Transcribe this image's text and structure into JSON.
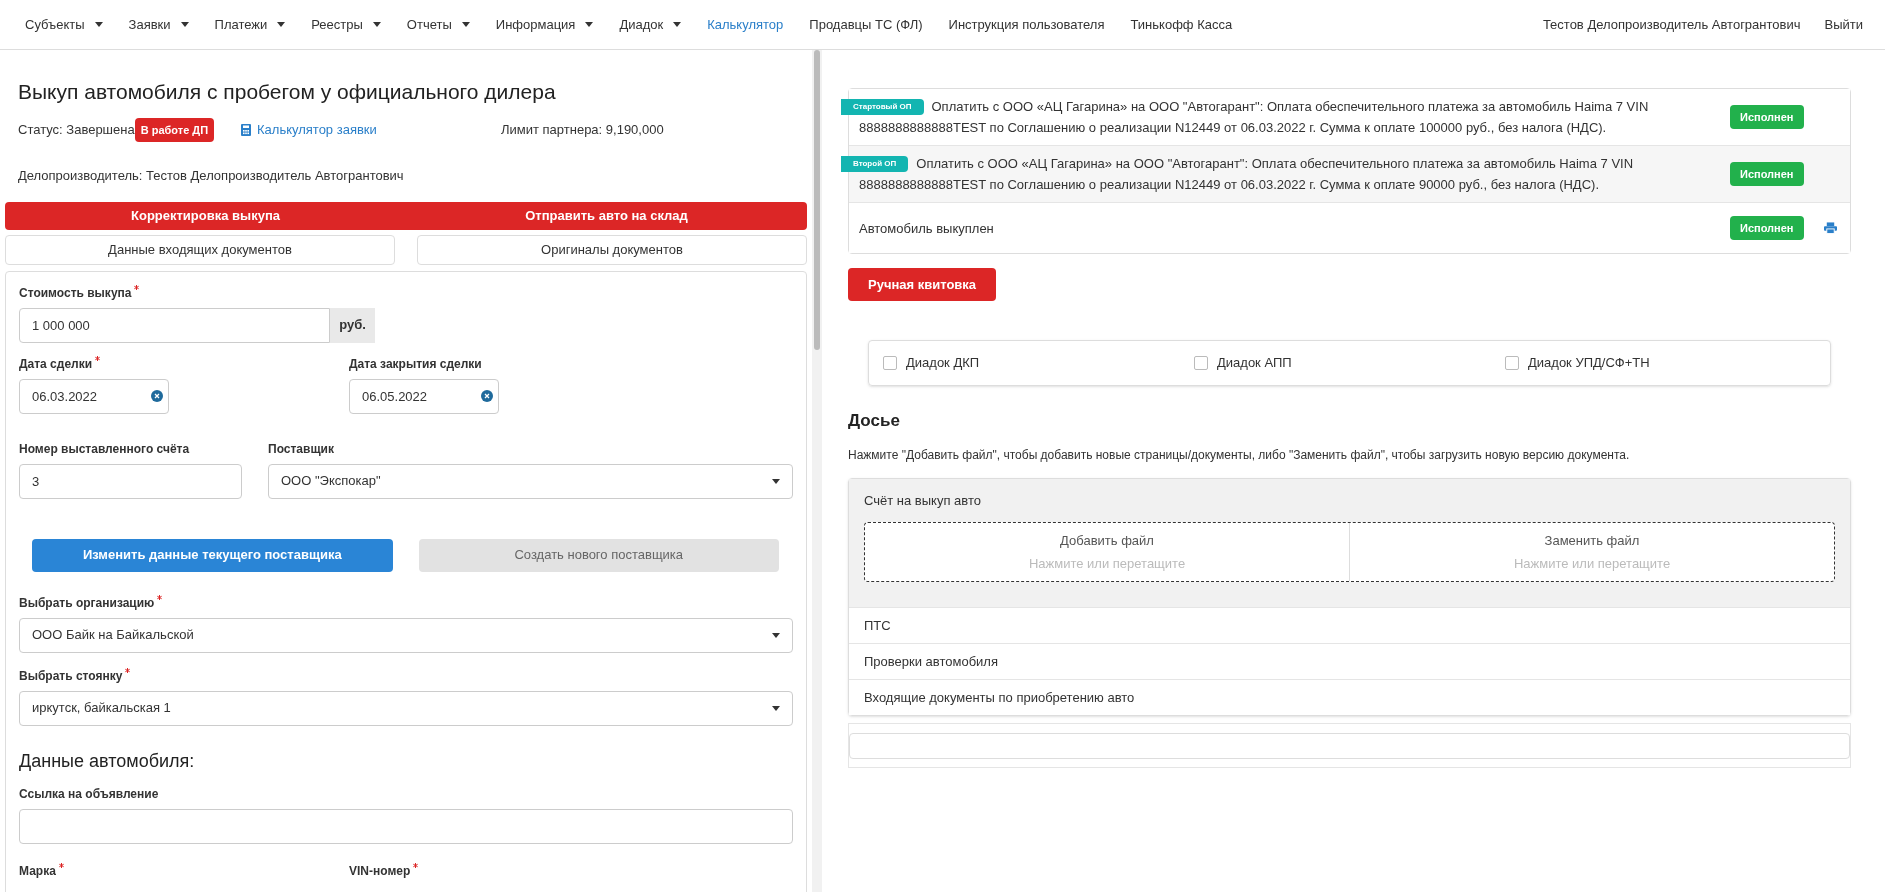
{
  "nav": {
    "items": [
      {
        "label": "Субъекты",
        "kind": "dropdown",
        "selected": false
      },
      {
        "label": "Заявки",
        "kind": "dropdown",
        "selected": false
      },
      {
        "label": "Платежи",
        "kind": "dropdown",
        "selected": false
      },
      {
        "label": "Реестры",
        "kind": "dropdown",
        "selected": false
      },
      {
        "label": "Отчеты",
        "kind": "dropdown",
        "selected": false
      },
      {
        "label": "Информация",
        "kind": "dropdown",
        "selected": false
      },
      {
        "label": "Диадок",
        "kind": "dropdown",
        "selected": false
      },
      {
        "label": "Калькулятор",
        "kind": "link",
        "selected": true
      },
      {
        "label": "Продавцы ТС (ФЛ)",
        "kind": "link",
        "selected": false
      },
      {
        "label": "Инструкция пользователя",
        "kind": "link",
        "selected": false
      },
      {
        "label": "Тинькофф Касса",
        "kind": "link",
        "selected": false
      }
    ],
    "user": "Тестов Делопроизводитель Автогрантович",
    "logout": "Выйти"
  },
  "header": {
    "title": "Выкуп автомобиля с пробегом у официального дилера",
    "status": "Статус: Завершена",
    "status_badge": "В работе ДП",
    "calculator_link": "Калькулятор заявки",
    "limit": "Лимит партнера: 9,190,000",
    "clerk": "Делопроизводитель: Тестов Делопроизводитель Автогрантович"
  },
  "action_bar": [
    "Корректировка выкупа",
    "Отправить авто на склад"
  ],
  "doc_buttons": [
    "Данные входящих документов",
    "Оригиналы документов"
  ],
  "form": {
    "price": {
      "label": "Стоимость выкупа",
      "required": true,
      "value": "1 000 000",
      "suffix": "руб."
    },
    "deal_date": {
      "label": "Дата сделки",
      "required": true,
      "value": "06.03.2022"
    },
    "close_date": {
      "label": "Дата закрытия сделки",
      "required": false,
      "value": "06.05.2022"
    },
    "invoice": {
      "label": "Номер выставленного счёта",
      "required": false,
      "value": "3"
    },
    "supplier": {
      "label": "Поставщик",
      "required": false,
      "value": "ООО \"Экспокар\""
    },
    "supplier_buttons": [
      {
        "label": "Изменить данные текущего поставщика",
        "disabled": false
      },
      {
        "label": "Создать нового поставщика",
        "disabled": true
      }
    ],
    "organization": {
      "label": "Выбрать организацию",
      "required": true,
      "value": "ООО Байк на Байкальской"
    },
    "parking": {
      "label": "Выбрать стоянку",
      "required": true,
      "value": "иркутск, байкальская 1"
    },
    "car_heading": "Данные автомобиля:",
    "ad_link": {
      "label": "Ссылка на объявление",
      "required": false
    },
    "brand": {
      "label": "Марка",
      "required": true
    },
    "vin": {
      "label": "VIN-номер",
      "required": true
    }
  },
  "steps": [
    {
      "badge": "Стартовый ОП",
      "text": "Оплатить с ООО «АЦ Гагарина» на ООО \"Автогарант\": Оплата обеспечительного платежа за автомобиль Haima 7 VIN 8888888888888TEST по Соглашению о реализации N12449 от 06.03.2022 г. Сумма к оплате 100000 руб., без налога (НДС).",
      "status": "Исполнен",
      "printable": false
    },
    {
      "badge": "Второй ОП",
      "text": "Оплатить с ООО «АЦ Гагарина» на ООО \"Автогарант\": Оплата обеспечительного платежа за автомобиль Haima 7 VIN 8888888888888TEST по Соглашению о реализации N12449 от 06.03.2022 г. Сумма к оплате 90000 руб., без налога (НДС).",
      "status": "Исполнен",
      "printable": false
    },
    {
      "text": "Автомобиль выкуплен",
      "status": "Исполнен",
      "printable": true
    }
  ],
  "manual_button": "Ручная квитовка",
  "diadoc": [
    {
      "label": "Диадок ДКП",
      "checked": false
    },
    {
      "label": "Диадок АПП",
      "checked": false
    },
    {
      "label": "Диадок УПД/СФ+ТН",
      "checked": false
    }
  ],
  "dossier": {
    "title": "Досье",
    "hint": "Нажмите \"Добавить файл\", чтобы добавить новые страницы/документы, либо \"Заменить файл\", чтобы загрузить новую версию документа.",
    "sections": [
      {
        "title": "Счёт на выкуп авто",
        "expanded": true,
        "add_label": "Добавить файл",
        "add_hint": "Нажмите или перетащите",
        "replace_label": "Заменить файл",
        "replace_hint": "Нажмите или перетащите"
      },
      {
        "title": "ПТС",
        "expanded": false
      },
      {
        "title": "Проверки автомобиля",
        "expanded": false
      },
      {
        "title": "Входящие документы по приобретению авто",
        "expanded": false
      }
    ]
  }
}
